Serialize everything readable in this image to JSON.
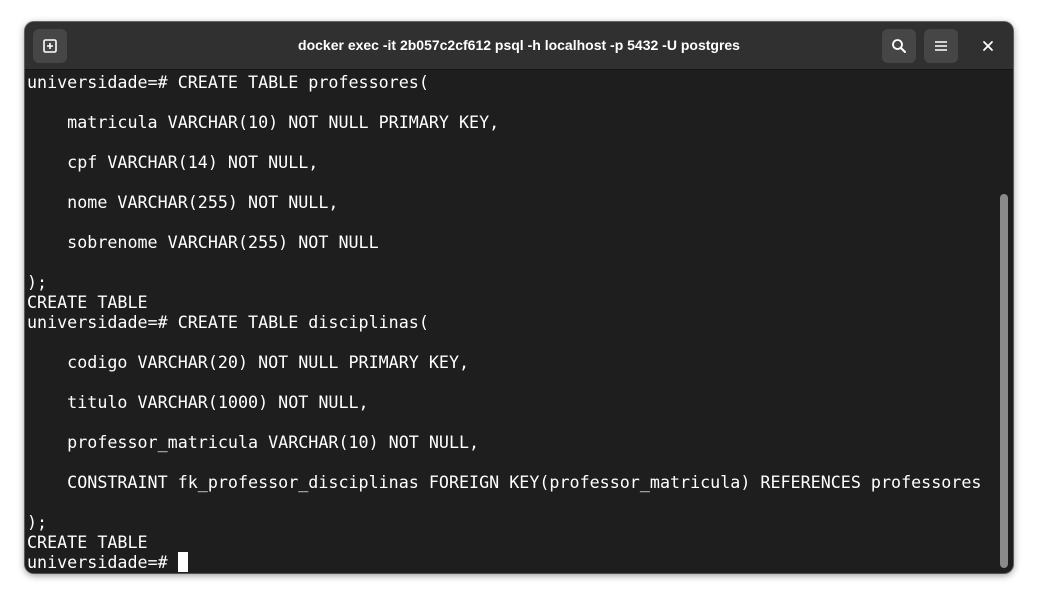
{
  "window": {
    "title": "docker exec -it 2b057c2cf612 psql -h localhost -p 5432 -U postgres"
  },
  "icons": {
    "new_tab": "new-tab-icon",
    "search": "search-icon",
    "menu": "hamburger-menu-icon",
    "close": "close-icon"
  },
  "colors": {
    "titlebar_bg": "#303030",
    "terminal_bg": "#1e1e1e",
    "text": "#ffffff",
    "button_bg": "#464646"
  },
  "terminal": {
    "lines": [
      "universidade=# CREATE TABLE professores(",
      "",
      "    matricula VARCHAR(10) NOT NULL PRIMARY KEY,",
      "",
      "    cpf VARCHAR(14) NOT NULL,",
      "",
      "    nome VARCHAR(255) NOT NULL,",
      "",
      "    sobrenome VARCHAR(255) NOT NULL",
      "",
      ");",
      "CREATE TABLE",
      "universidade=# CREATE TABLE disciplinas(",
      "",
      "    codigo VARCHAR(20) NOT NULL PRIMARY KEY,",
      "",
      "    titulo VARCHAR(1000) NOT NULL,",
      "",
      "    professor_matricula VARCHAR(10) NOT NULL,",
      "",
      "    CONSTRAINT fk_professor_disciplinas FOREIGN KEY(professor_matricula) REFERENCES professores",
      "",
      ");",
      "CREATE TABLE"
    ],
    "prompt": "universidade=# "
  }
}
